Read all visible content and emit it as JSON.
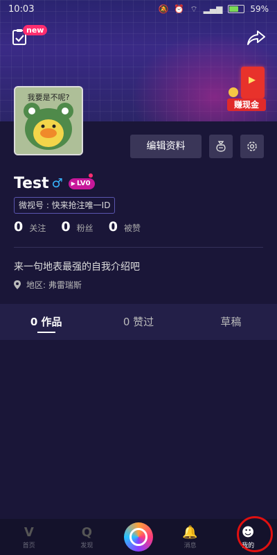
{
  "status_bar": {
    "time": "10:03",
    "battery_percent": "59%",
    "battery_level": 0.59
  },
  "header": {
    "new_badge": "new",
    "promo_label": "赚现金"
  },
  "profile": {
    "avatar_caption": "我要是不呢?",
    "edit_button": "编辑资料",
    "username": "Test",
    "gender_symbol": "♂",
    "level": "LV0",
    "weishi_id": "微视号 : 快来抢注唯一ID",
    "stats": [
      {
        "num": "0",
        "label": "关注"
      },
      {
        "num": "0",
        "label": "粉丝"
      },
      {
        "num": "0",
        "label": "被赞"
      }
    ],
    "bio": "来一句地表最强的自我介绍吧",
    "region": "地区: 弗雷瑞斯"
  },
  "tabs": [
    {
      "label": "0 作品"
    },
    {
      "label": "0 赞过"
    },
    {
      "label": "草稿"
    }
  ],
  "bottom_nav": [
    {
      "label": "首页",
      "icon": "home-icon"
    },
    {
      "label": "发现",
      "icon": "discover-icon"
    },
    {
      "label": "消息",
      "icon": "bell-icon"
    },
    {
      "label": "我的",
      "icon": "profile-icon"
    }
  ]
}
